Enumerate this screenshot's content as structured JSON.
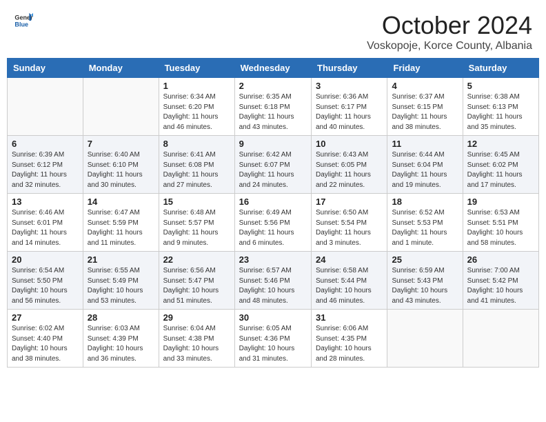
{
  "header": {
    "logo_general": "General",
    "logo_blue": "Blue",
    "month": "October 2024",
    "location": "Voskopoje, Korce County, Albania"
  },
  "weekdays": [
    "Sunday",
    "Monday",
    "Tuesday",
    "Wednesday",
    "Thursday",
    "Friday",
    "Saturday"
  ],
  "weeks": [
    [
      {
        "day": "",
        "detail": ""
      },
      {
        "day": "",
        "detail": ""
      },
      {
        "day": "1",
        "detail": "Sunrise: 6:34 AM\nSunset: 6:20 PM\nDaylight: 11 hours\nand 46 minutes."
      },
      {
        "day": "2",
        "detail": "Sunrise: 6:35 AM\nSunset: 6:18 PM\nDaylight: 11 hours\nand 43 minutes."
      },
      {
        "day": "3",
        "detail": "Sunrise: 6:36 AM\nSunset: 6:17 PM\nDaylight: 11 hours\nand 40 minutes."
      },
      {
        "day": "4",
        "detail": "Sunrise: 6:37 AM\nSunset: 6:15 PM\nDaylight: 11 hours\nand 38 minutes."
      },
      {
        "day": "5",
        "detail": "Sunrise: 6:38 AM\nSunset: 6:13 PM\nDaylight: 11 hours\nand 35 minutes."
      }
    ],
    [
      {
        "day": "6",
        "detail": "Sunrise: 6:39 AM\nSunset: 6:12 PM\nDaylight: 11 hours\nand 32 minutes."
      },
      {
        "day": "7",
        "detail": "Sunrise: 6:40 AM\nSunset: 6:10 PM\nDaylight: 11 hours\nand 30 minutes."
      },
      {
        "day": "8",
        "detail": "Sunrise: 6:41 AM\nSunset: 6:08 PM\nDaylight: 11 hours\nand 27 minutes."
      },
      {
        "day": "9",
        "detail": "Sunrise: 6:42 AM\nSunset: 6:07 PM\nDaylight: 11 hours\nand 24 minutes."
      },
      {
        "day": "10",
        "detail": "Sunrise: 6:43 AM\nSunset: 6:05 PM\nDaylight: 11 hours\nand 22 minutes."
      },
      {
        "day": "11",
        "detail": "Sunrise: 6:44 AM\nSunset: 6:04 PM\nDaylight: 11 hours\nand 19 minutes."
      },
      {
        "day": "12",
        "detail": "Sunrise: 6:45 AM\nSunset: 6:02 PM\nDaylight: 11 hours\nand 17 minutes."
      }
    ],
    [
      {
        "day": "13",
        "detail": "Sunrise: 6:46 AM\nSunset: 6:01 PM\nDaylight: 11 hours\nand 14 minutes."
      },
      {
        "day": "14",
        "detail": "Sunrise: 6:47 AM\nSunset: 5:59 PM\nDaylight: 11 hours\nand 11 minutes."
      },
      {
        "day": "15",
        "detail": "Sunrise: 6:48 AM\nSunset: 5:57 PM\nDaylight: 11 hours\nand 9 minutes."
      },
      {
        "day": "16",
        "detail": "Sunrise: 6:49 AM\nSunset: 5:56 PM\nDaylight: 11 hours\nand 6 minutes."
      },
      {
        "day": "17",
        "detail": "Sunrise: 6:50 AM\nSunset: 5:54 PM\nDaylight: 11 hours\nand 3 minutes."
      },
      {
        "day": "18",
        "detail": "Sunrise: 6:52 AM\nSunset: 5:53 PM\nDaylight: 11 hours\nand 1 minute."
      },
      {
        "day": "19",
        "detail": "Sunrise: 6:53 AM\nSunset: 5:51 PM\nDaylight: 10 hours\nand 58 minutes."
      }
    ],
    [
      {
        "day": "20",
        "detail": "Sunrise: 6:54 AM\nSunset: 5:50 PM\nDaylight: 10 hours\nand 56 minutes."
      },
      {
        "day": "21",
        "detail": "Sunrise: 6:55 AM\nSunset: 5:49 PM\nDaylight: 10 hours\nand 53 minutes."
      },
      {
        "day": "22",
        "detail": "Sunrise: 6:56 AM\nSunset: 5:47 PM\nDaylight: 10 hours\nand 51 minutes."
      },
      {
        "day": "23",
        "detail": "Sunrise: 6:57 AM\nSunset: 5:46 PM\nDaylight: 10 hours\nand 48 minutes."
      },
      {
        "day": "24",
        "detail": "Sunrise: 6:58 AM\nSunset: 5:44 PM\nDaylight: 10 hours\nand 46 minutes."
      },
      {
        "day": "25",
        "detail": "Sunrise: 6:59 AM\nSunset: 5:43 PM\nDaylight: 10 hours\nand 43 minutes."
      },
      {
        "day": "26",
        "detail": "Sunrise: 7:00 AM\nSunset: 5:42 PM\nDaylight: 10 hours\nand 41 minutes."
      }
    ],
    [
      {
        "day": "27",
        "detail": "Sunrise: 6:02 AM\nSunset: 4:40 PM\nDaylight: 10 hours\nand 38 minutes."
      },
      {
        "day": "28",
        "detail": "Sunrise: 6:03 AM\nSunset: 4:39 PM\nDaylight: 10 hours\nand 36 minutes."
      },
      {
        "day": "29",
        "detail": "Sunrise: 6:04 AM\nSunset: 4:38 PM\nDaylight: 10 hours\nand 33 minutes."
      },
      {
        "day": "30",
        "detail": "Sunrise: 6:05 AM\nSunset: 4:36 PM\nDaylight: 10 hours\nand 31 minutes."
      },
      {
        "day": "31",
        "detail": "Sunrise: 6:06 AM\nSunset: 4:35 PM\nDaylight: 10 hours\nand 28 minutes."
      },
      {
        "day": "",
        "detail": ""
      },
      {
        "day": "",
        "detail": ""
      }
    ]
  ]
}
